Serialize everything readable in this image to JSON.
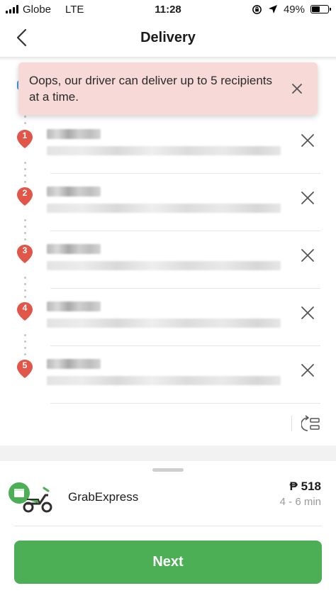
{
  "status_bar": {
    "carrier": "Globe",
    "network": "LTE",
    "time": "11:28",
    "battery": "49%",
    "battery_level": 0.49
  },
  "header": {
    "title": "Delivery",
    "back_icon": "chevron-left-icon"
  },
  "toast": {
    "message": "Oops, our driver can deliver up to 5 recipients at a time.",
    "close_icon": "close-icon",
    "background_color": "#f7d9d8"
  },
  "recipients": [
    {
      "number": "1"
    },
    {
      "number": "2"
    },
    {
      "number": "3"
    },
    {
      "number": "4"
    },
    {
      "number": "5"
    }
  ],
  "recipient_pin_color": "#e2564a",
  "pickup_color": "#3a9bd9",
  "reorder_icon": "reorder-icon",
  "service": {
    "name": "GrabExpress",
    "currency": "₱",
    "price": "518",
    "eta": "4 - 6 min",
    "icon": "grabexpress-scooter-icon"
  },
  "next_button": {
    "label": "Next",
    "color": "#4caf55"
  }
}
